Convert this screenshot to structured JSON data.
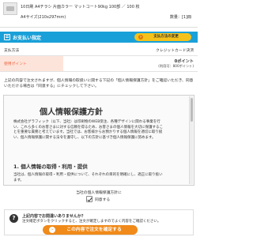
{
  "product": {
    "name": "10日刷 A4チラシ 片面カラー マットコート90kg 100部 ／ 100 枚",
    "size": "A4サイズ(210x297mm)",
    "qty_label": "数量",
    "qty_value": "[1]冊"
  },
  "payment_header": {
    "title": "お支払い指定",
    "change_button": "支払方法の変更"
  },
  "payment": {
    "method_label": "支払方法",
    "method_value": "クレジットカード決済",
    "points_label": "使用ポイント",
    "points_value": "0ポイント",
    "points_available": "(利用可：800ポイント)"
  },
  "note": "上記の内容で注文されますが、個人情報の取扱いに関する下記の「個人情報保護方針」をご確認いただき、同意いただける場合は「同意する」にチェックして下さい。",
  "policy": {
    "title": "個人情報保護方針",
    "body": "株式会社グラフィック（以下、当社）は印刷物のWEB受注、各種デザインに関わる事業を行い、これら多くのお客さまに対する信頼を得るため、お客さまの個人情報を大切に保護することを重要な責務と考えています。当社では、お客様からお預かりする個人情報を適切に取り扱い、個人情報保護に関する法令を遵守し、以下の方針に基づき個人情報保護に努めます。",
    "section_title": "1. 個人情報の取得・利用・提供",
    "section_body": "当社は、個人情報の取得・利用・提供について、それぞれの目的を明確にし、適正に取り扱います。"
  },
  "agree": {
    "prompt": "当社の個人情報保護方針に",
    "label": "同意する"
  },
  "confirm": {
    "question": "上記内容でお間違いありませんか？",
    "instruction": "注文確定ボタンをクリックすると、注文が確定しますのでよく内容をご確認ください。",
    "button": "この内容で注文を確定する"
  }
}
